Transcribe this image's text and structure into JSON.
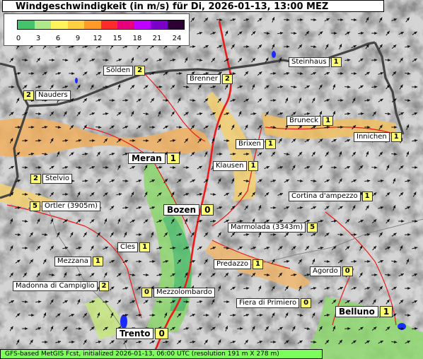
{
  "title": "Windgeschwindigkeit (in m/s) für Di, 2026-01-13, 13:00 MEZ",
  "legend": {
    "colors": [
      "#44c26c",
      "#aee88a",
      "#fff45a",
      "#ffd040",
      "#ff9a2a",
      "#ff2a2a",
      "#e8007c",
      "#c000ff",
      "#7a00c8",
      "#2c0036"
    ],
    "ticks": [
      "0",
      "3",
      "6",
      "9",
      "12",
      "15",
      "18",
      "21",
      "24"
    ]
  },
  "places": [
    {
      "name": "Sölden",
      "value": "2",
      "big": false,
      "side": "left"
    },
    {
      "name": "Steinhaus",
      "value": "1",
      "big": false,
      "side": "left"
    },
    {
      "name": "Brenner",
      "value": "2",
      "big": false,
      "side": "left"
    },
    {
      "name": "Nauders",
      "value": "2",
      "big": false,
      "side": "right"
    },
    {
      "name": "Bruneck",
      "value": "1",
      "big": false,
      "side": "left"
    },
    {
      "name": "Innichen",
      "value": "1",
      "big": false,
      "side": "left"
    },
    {
      "name": "Brixen",
      "value": "1",
      "big": false,
      "side": "left"
    },
    {
      "name": "Meran",
      "value": "1",
      "big": true,
      "side": "left"
    },
    {
      "name": "Klausen",
      "value": "1",
      "big": false,
      "side": "left"
    },
    {
      "name": "Stelvio",
      "value": "2",
      "big": false,
      "side": "right"
    },
    {
      "name": "Cortina d'ampezzo",
      "value": "1",
      "big": false,
      "side": "left"
    },
    {
      "name": "Ortler (3905m)",
      "value": "5",
      "big": false,
      "side": "right"
    },
    {
      "name": "Bozen",
      "value": "0",
      "big": true,
      "side": "left"
    },
    {
      "name": "Marmolada (3343m)",
      "value": "5",
      "big": false,
      "side": "left"
    },
    {
      "name": "Cles",
      "value": "1",
      "big": false,
      "side": "left"
    },
    {
      "name": "Mezzana",
      "value": "1",
      "big": false,
      "side": "left"
    },
    {
      "name": "Predazzo",
      "value": "1",
      "big": false,
      "side": "left"
    },
    {
      "name": "Agordo",
      "value": "0",
      "big": false,
      "side": "left"
    },
    {
      "name": "Madonna di Campiglio",
      "value": "2",
      "big": false,
      "side": "left"
    },
    {
      "name": "Mezzolombardo",
      "value": "0",
      "big": false,
      "side": "right"
    },
    {
      "name": "Fiera di Primiero",
      "value": "0",
      "big": false,
      "side": "left"
    },
    {
      "name": "Belluno",
      "value": "1",
      "big": true,
      "side": "left"
    },
    {
      "name": "Trento",
      "value": "0",
      "big": true,
      "side": "left"
    }
  ],
  "footer": "GFS-based MetGIS Fcst, initialized 2026-01-13, 06:00 UTC  (resolution 191 m X 278 m)"
}
